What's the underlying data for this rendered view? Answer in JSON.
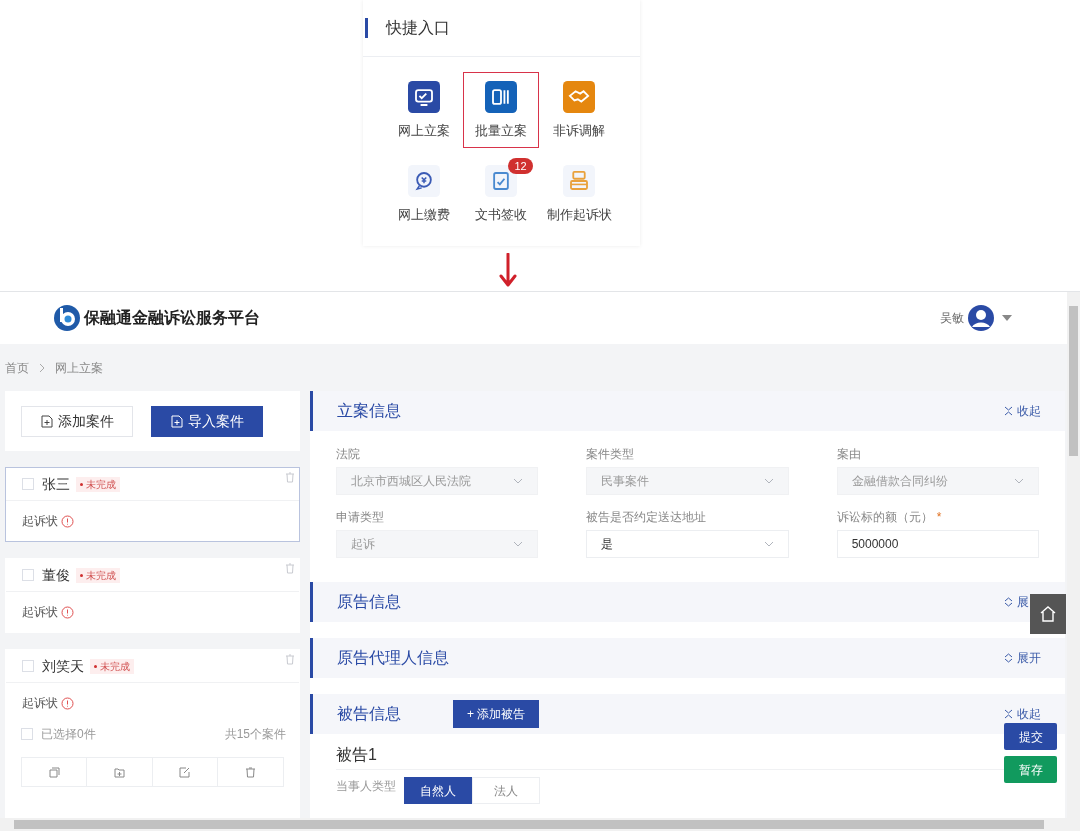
{
  "quick_entry": {
    "title": "快捷入口",
    "items": [
      {
        "label": "网上立案",
        "selected": false,
        "kind": "monitor",
        "color": "#2a4aa5",
        "solid": true
      },
      {
        "label": "批量立案",
        "selected": true,
        "kind": "batch",
        "color": "#1462b8",
        "solid": true
      },
      {
        "label": "非诉调解",
        "selected": false,
        "kind": "handshake",
        "color": "#e5870f",
        "solid": true
      },
      {
        "label": "网上缴费",
        "selected": false,
        "kind": "yen",
        "color": "#3b5bb5",
        "solid": false
      },
      {
        "label": "文书签收",
        "selected": false,
        "kind": "doc",
        "color": "#4a8ad0",
        "solid": false,
        "badge": "12"
      },
      {
        "label": "制作起诉状",
        "selected": false,
        "kind": "printer",
        "color": "#e9a13b",
        "solid": false
      }
    ]
  },
  "header": {
    "platform_name": "保融通金融诉讼服务平台",
    "user": "吴敏"
  },
  "breadcrumb": [
    "首页",
    "网上立案"
  ],
  "left_panel": {
    "buttons": [
      {
        "label": "添加案件",
        "kind": "outline"
      },
      {
        "label": "导入案件",
        "kind": "primary"
      }
    ],
    "cases": [
      {
        "name": "张三",
        "status": "未完成",
        "doc": "起诉状",
        "selected": true,
        "checked": false
      },
      {
        "name": "董俊",
        "status": "未完成",
        "doc": "起诉状",
        "selected": false,
        "checked": false
      },
      {
        "name": "刘笑天",
        "status": "未完成",
        "doc": "起诉状",
        "selected": false,
        "checked": false
      }
    ],
    "select_all": {
      "label": "已选择0件",
      "checked": false
    },
    "total": "共15个案件"
  },
  "sections": [
    {
      "title": "立案信息",
      "toggle": "收起",
      "expanded": true,
      "fields": [
        {
          "label": "法院",
          "value": "北京市西城区人民法院",
          "kind": "select",
          "disabled": true
        },
        {
          "label": "案件类型",
          "value": "民事案件",
          "kind": "select",
          "disabled": true
        },
        {
          "label": "案由",
          "value": "金融借款合同纠纷",
          "kind": "select",
          "disabled": true
        },
        {
          "label": "申请类型",
          "value": "起诉",
          "kind": "select",
          "disabled": true
        },
        {
          "label": "被告是否约定送达地址",
          "value": "是",
          "kind": "select",
          "disabled": false
        },
        {
          "label": "诉讼标的额（元）",
          "value": "5000000",
          "kind": "input",
          "disabled": false,
          "required_mark": "*"
        }
      ]
    },
    {
      "title": "原告信息",
      "toggle": "展",
      "expanded": false
    },
    {
      "title": "原告代理人信息",
      "toggle": "展开",
      "expanded": false
    },
    {
      "title": "被告信息",
      "toggle": "收起",
      "expanded": true,
      "action": "+ 添加被告",
      "subtitle": "被告1",
      "party_label": "当事人类型",
      "party_tabs": [
        {
          "label": "自然人",
          "selected": true
        },
        {
          "label": "法人",
          "selected": false
        }
      ]
    }
  ],
  "float_buttons": [
    {
      "label": "提交",
      "kind": "primary"
    },
    {
      "label": "暂存",
      "kind": "save"
    }
  ]
}
